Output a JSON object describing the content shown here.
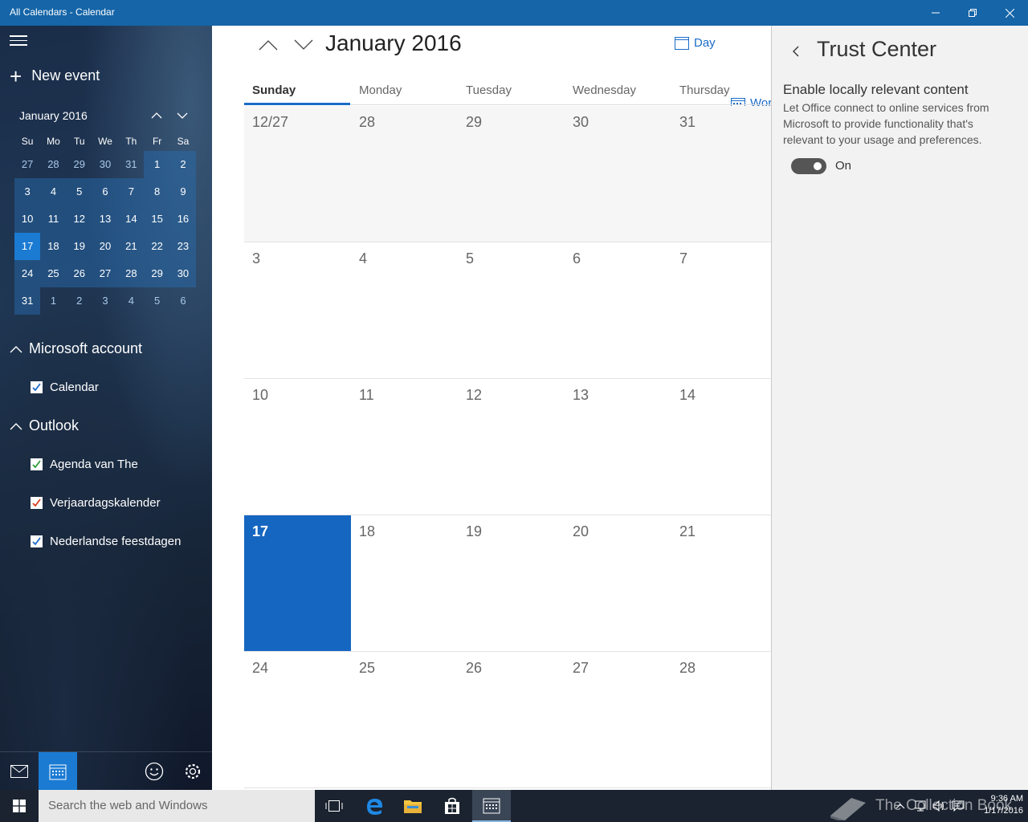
{
  "window": {
    "title": "All Calendars - Calendar"
  },
  "sidebar": {
    "new_event": "New event",
    "mini_month": "January 2016",
    "weekday_headers": [
      "Su",
      "Mo",
      "Tu",
      "We",
      "Th",
      "Fr",
      "Sa"
    ],
    "weeks": [
      [
        "27",
        "28",
        "29",
        "30",
        "31",
        "1",
        "2"
      ],
      [
        "3",
        "4",
        "5",
        "6",
        "7",
        "8",
        "9"
      ],
      [
        "10",
        "11",
        "12",
        "13",
        "14",
        "15",
        "16"
      ],
      [
        "17",
        "18",
        "19",
        "20",
        "21",
        "22",
        "23"
      ],
      [
        "24",
        "25",
        "26",
        "27",
        "28",
        "29",
        "30"
      ],
      [
        "31",
        "1",
        "2",
        "3",
        "4",
        "5",
        "6"
      ]
    ],
    "accounts": [
      {
        "name": "Microsoft account",
        "calendars": [
          {
            "label": "Calendar",
            "color": "#1b6bc7",
            "checked": true
          }
        ]
      },
      {
        "name": "Outlook",
        "calendars": [
          {
            "label": "Agenda van The",
            "color": "#2e9d3a",
            "checked": true
          },
          {
            "label": "Verjaardagskalender",
            "color": "#d83b1f",
            "checked": true
          },
          {
            "label": "Nederlandse feestdagen",
            "color": "#1b6bc7",
            "checked": true
          }
        ]
      }
    ]
  },
  "main": {
    "month_title": "January 2016",
    "views": {
      "day": "Day",
      "week": "Wor"
    },
    "weekdays": [
      "Sunday",
      "Monday",
      "Tuesday",
      "Wednesday",
      "Thursday"
    ],
    "weeks": [
      [
        "12/27",
        "28",
        "29",
        "30",
        "31"
      ],
      [
        "3",
        "4",
        "5",
        "6",
        "7"
      ],
      [
        "10",
        "11",
        "12",
        "13",
        "14"
      ],
      [
        "17",
        "18",
        "19",
        "20",
        "21"
      ],
      [
        "24",
        "25",
        "26",
        "27",
        "28"
      ]
    ],
    "today": "17"
  },
  "trust_center": {
    "title": "Trust Center",
    "setting_title": "Enable locally relevant content",
    "setting_desc": "Let Office connect to online services from Microsoft to provide functionality that's relevant to your usage and preferences.",
    "toggle_state": "On",
    "toggle_on": true
  },
  "taskbar": {
    "search_placeholder": "Search the web and Windows",
    "watermark": "The Collection Book",
    "time": "9:36 AM",
    "date": "1/17/2016"
  },
  "colors": {
    "accent": "#1b6bc7",
    "titlebar": "#1565a8",
    "today": "#1566c0"
  }
}
